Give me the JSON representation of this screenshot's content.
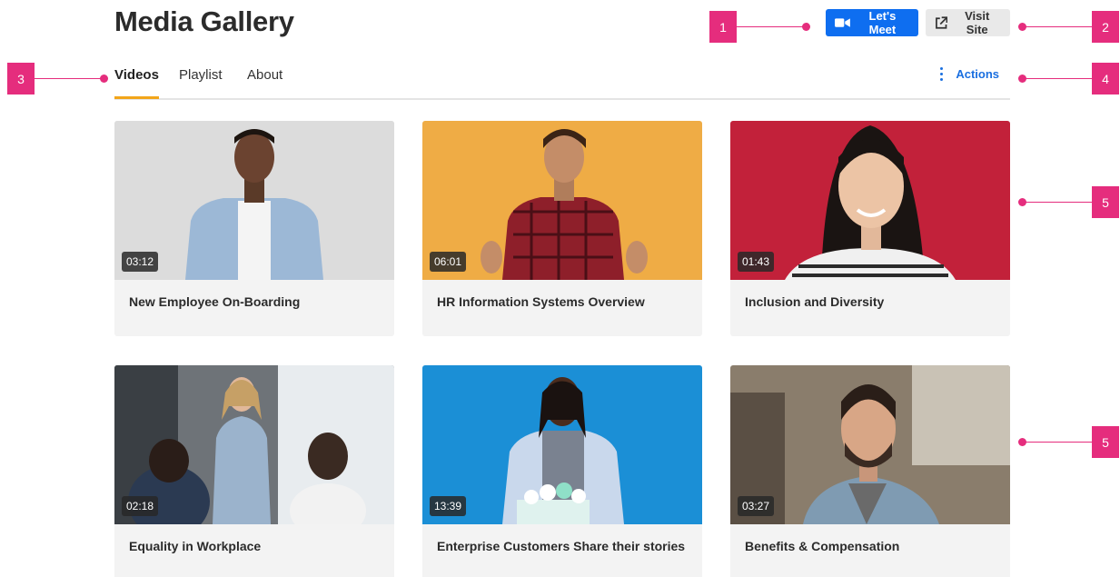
{
  "page": {
    "title": "Media Gallery"
  },
  "header": {
    "meet_label": "Let's Meet",
    "visit_label": "Visit Site"
  },
  "tabs": [
    {
      "label": "Videos",
      "active": true
    },
    {
      "label": "Playlist",
      "active": false
    },
    {
      "label": "About",
      "active": false
    }
  ],
  "actions_label": "Actions",
  "videos": [
    {
      "title": "New Employee On-Boarding",
      "duration": "03:12",
      "bg": "#dcdcdc"
    },
    {
      "title": "HR Information Systems Overview",
      "duration": "06:01",
      "bg": "#efac45"
    },
    {
      "title": "Inclusion and Diversity",
      "duration": "01:43",
      "bg": "#c2213a"
    },
    {
      "title": "Equality in Workplace",
      "duration": "02:18",
      "bg": "#6e7378"
    },
    {
      "title": "Enterprise Customers Share their stories",
      "duration": "13:39",
      "bg": "#1b8fd6"
    },
    {
      "title": "Benefits & Compensation",
      "duration": "03:27",
      "bg": "#8a7d6c"
    }
  ],
  "annotations": [
    "1",
    "2",
    "3",
    "4",
    "5",
    "5"
  ],
  "colors": {
    "accent": "#e52d7d",
    "primary": "#0e6ef0",
    "tab_underline": "#f2a51a",
    "link": "#1a6fe0"
  }
}
